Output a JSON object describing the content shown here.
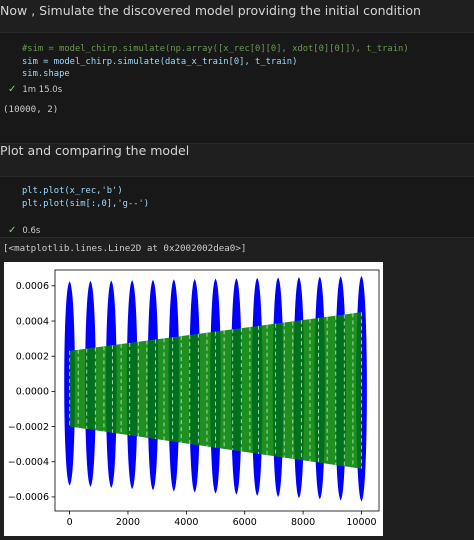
{
  "cell1": {
    "markdown": "Now , Simulate the discovered model providing the initial condition",
    "code": [
      "#sim = model_chirp.simulate(np.array([x_rec[0][0], xdot[0][0]]), t_train)",
      "sim = model_chirp.simulate(data_x_train[0], t_train)",
      "sim.shape"
    ],
    "exec_time": "1m 15.0s",
    "output": "(10000, 2)"
  },
  "cell2": {
    "markdown": "Plot and comparing the model",
    "code": [
      "plt.plot(x_rec,'b')",
      "plt.plot(sim[:,0],'g--')"
    ],
    "exec_time": "0.6s",
    "output": "[<matplotlib.lines.Line2D at 0x2002002dea0>]"
  },
  "chart_data": {
    "type": "line",
    "title": "",
    "xlabel": "",
    "ylabel": "",
    "xlim": [
      -500,
      10600
    ],
    "ylim": [
      -0.00068,
      0.00069
    ],
    "x_ticks": [
      "0",
      "2000",
      "4000",
      "6000",
      "8000",
      "10000"
    ],
    "x_tick_values": [
      0,
      2000,
      4000,
      6000,
      8000,
      10000
    ],
    "y_ticks": [
      "0.0006",
      "0.0004",
      "0.0002",
      "0.0000",
      "−0.0002",
      "−0.0004",
      "−0.0006"
    ],
    "y_tick_values": [
      0.0006,
      0.0004,
      0.0002,
      0.0,
      -0.0002,
      -0.0004,
      -0.0006
    ],
    "series": [
      {
        "style": "b",
        "color": "#0000ff",
        "x": [
          0,
          10000
        ],
        "burst_count": 15,
        "upper": [
          0.00062,
          0.00065
        ],
        "lower": [
          -0.00053,
          -0.00062
        ]
      },
      {
        "style": "g--",
        "color": "#008000",
        "x": [
          0,
          10000
        ],
        "upper": [
          0.00023,
          0.00045
        ],
        "lower": [
          -0.0002,
          -0.00044
        ]
      }
    ]
  }
}
